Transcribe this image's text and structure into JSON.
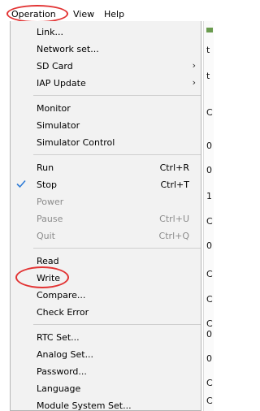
{
  "menubar": {
    "operation": "Operation",
    "view": "View",
    "help": "Help"
  },
  "behind_fragments": [
    "t",
    "t",
    "C",
    "0",
    "0",
    "1",
    "C",
    "0",
    "C",
    "C",
    "C",
    "0",
    "0",
    "C",
    "C"
  ],
  "menu": {
    "items": [
      {
        "label": "Link..."
      },
      {
        "label": "Network set..."
      },
      {
        "label": "SD Card",
        "submenu": true
      },
      {
        "label": "IAP Update",
        "submenu": true
      },
      {
        "label": "Monitor"
      },
      {
        "label": "Simulator"
      },
      {
        "label": "Simulator Control"
      },
      {
        "label": "Run",
        "shortcut": "Ctrl+R"
      },
      {
        "label": "Stop",
        "shortcut": "Ctrl+T",
        "checked": true
      },
      {
        "label": "Power",
        "disabled": true
      },
      {
        "label": "Pause",
        "shortcut": "Ctrl+U",
        "disabled": true
      },
      {
        "label": "Quit",
        "shortcut": "Ctrl+Q",
        "disabled": true
      },
      {
        "label": "Read"
      },
      {
        "label": "Write"
      },
      {
        "label": "Compare..."
      },
      {
        "label": "Check Error"
      },
      {
        "label": "RTC Set..."
      },
      {
        "label": "Analog Set..."
      },
      {
        "label": "Password..."
      },
      {
        "label": "Language"
      },
      {
        "label": "Module System Set..."
      }
    ]
  },
  "colors": {
    "highlight_ring": "#e23333",
    "check": "#2e7bd6"
  }
}
